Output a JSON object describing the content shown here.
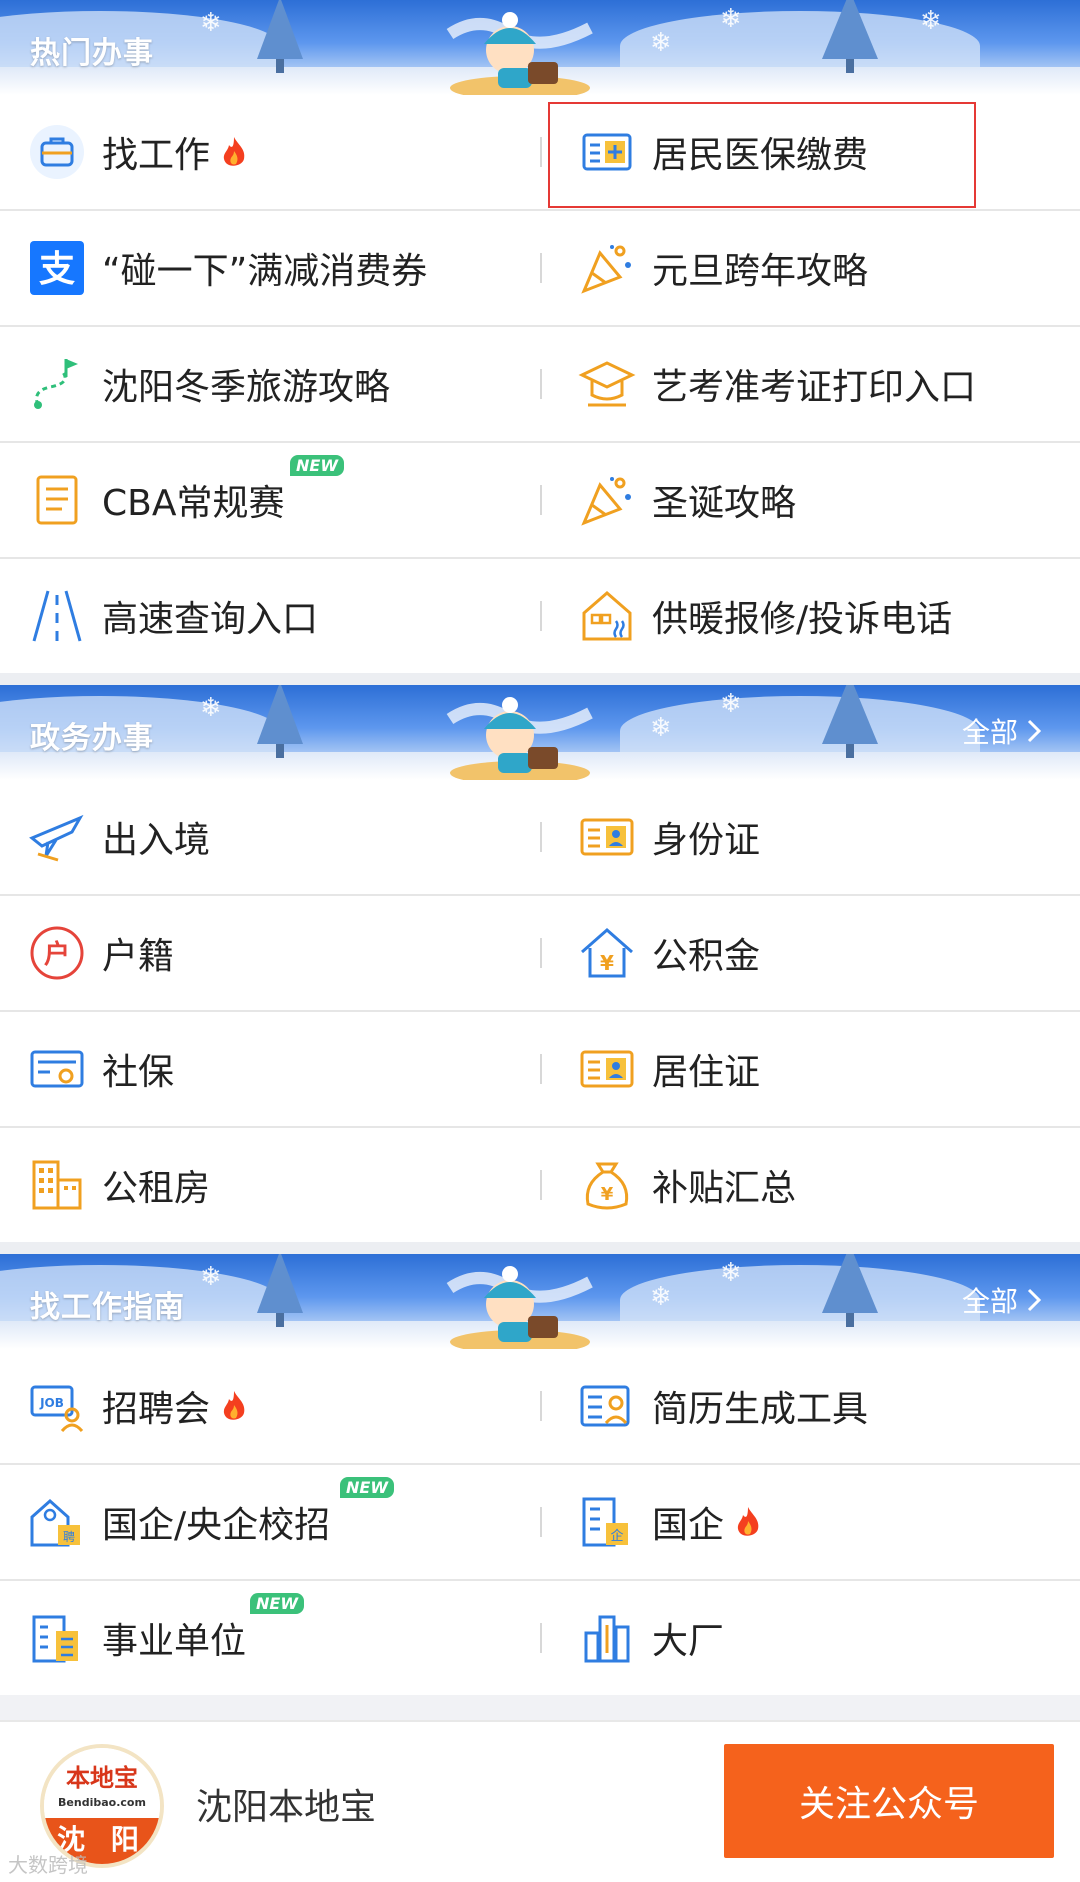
{
  "sections": [
    {
      "title": "热门办事",
      "all_label": "",
      "rows": [
        {
          "left": {
            "icon": "briefcase-icon",
            "label": "找工作",
            "hot": true
          },
          "right": {
            "icon": "medical-card-icon",
            "label": "居民医保缴费"
          }
        },
        {
          "left": {
            "icon": "alipay-icon",
            "label": "“碰一下”满减消费券"
          },
          "right": {
            "icon": "party-popper-icon",
            "label": "元旦跨年攻略"
          }
        },
        {
          "left": {
            "icon": "route-flag-icon",
            "label": "沈阳冬季旅游攻略"
          },
          "right": {
            "icon": "graduation-cap-icon",
            "label": "艺考准考证打印入口"
          }
        },
        {
          "left": {
            "icon": "notepad-icon",
            "label": "CBA常规赛",
            "new": true
          },
          "right": {
            "icon": "party-popper-icon",
            "label": "圣诞攻略"
          }
        },
        {
          "left": {
            "icon": "highway-icon",
            "label": "高速查询入口"
          },
          "right": {
            "icon": "heating-house-icon",
            "label": "供暖报修/投诉电话"
          }
        }
      ]
    },
    {
      "title": "政务办事",
      "all_label": "全部",
      "rows": [
        {
          "left": {
            "icon": "airplane-icon",
            "label": "出入境"
          },
          "right": {
            "icon": "id-card-icon",
            "label": "身份证"
          }
        },
        {
          "left": {
            "icon": "household-register-icon",
            "label": "户籍"
          },
          "right": {
            "icon": "housing-fund-icon",
            "label": "公积金"
          }
        },
        {
          "left": {
            "icon": "social-security-card-icon",
            "label": "社保"
          },
          "right": {
            "icon": "id-card-icon",
            "label": "居住证"
          }
        },
        {
          "left": {
            "icon": "buildings-icon",
            "label": "公租房"
          },
          "right": {
            "icon": "money-bag-icon",
            "label": "补贴汇总"
          }
        }
      ]
    },
    {
      "title": "找工作指南",
      "all_label": "全部",
      "rows": [
        {
          "left": {
            "icon": "job-fair-icon",
            "label": "招聘会",
            "hot": true
          },
          "right": {
            "icon": "resume-icon",
            "label": "简历生成工具"
          }
        },
        {
          "left": {
            "icon": "campus-recruit-icon",
            "label": "国企/央企校招",
            "new": true
          },
          "right": {
            "icon": "state-enterprise-icon",
            "label": "国企",
            "hot": true
          }
        },
        {
          "left": {
            "icon": "institution-icon",
            "label": "事业单位",
            "new": true
          },
          "right": {
            "icon": "factory-icon",
            "label": "大厂"
          }
        }
      ]
    }
  ],
  "new_badge": "NEW",
  "footer": {
    "logo_top": "本地宝",
    "logo_mid": "Bendibao.com",
    "logo_bottom": "沈 阳",
    "account_name": "沈阳本地宝",
    "follow_label": "关注公众号"
  },
  "watermark": "大数跨境",
  "colors": {
    "accent_orange": "#f5621c",
    "header_blue": "#2d6fd6",
    "icon_orange": "#f0a020",
    "icon_blue": "#2f7de1"
  }
}
